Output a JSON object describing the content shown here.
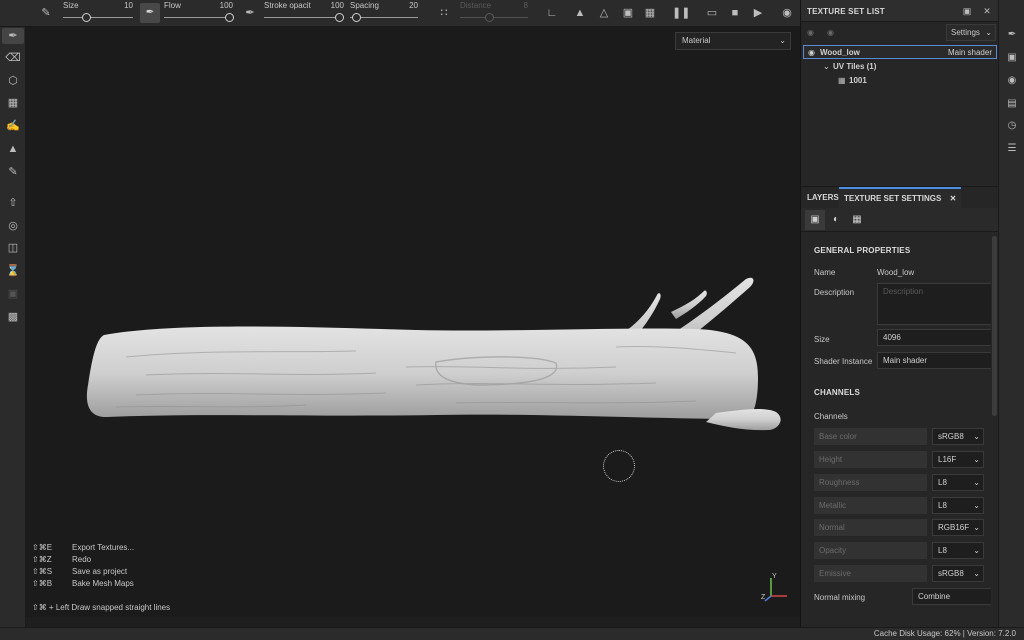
{
  "toolbar": {
    "sliders": [
      {
        "label": "Size",
        "value": "10",
        "level": 0.1
      },
      {
        "label": "Flow",
        "value": "100",
        "level": 1.0
      },
      {
        "label": "Stroke opacit",
        "value": "100",
        "level": 1.0
      },
      {
        "label": "Spacing",
        "value": "20",
        "level": 0.05
      },
      {
        "label": "Distance",
        "value": "8",
        "level": 0.5
      }
    ],
    "icons": [
      "lazy-mouse-icon",
      "brush-stroke-icon",
      "brush-tip-icon",
      "alignment-icon",
      "pattern-icon",
      "symmetry-icon",
      "mirror-icon",
      "snap-icon",
      "crop-icon",
      "pause-icon",
      "frame-icon",
      "cube-icon",
      "camera-icon",
      "screenshot-icon"
    ]
  },
  "left_tools": [
    "paint-brush-icon",
    "eraser-icon",
    "projection-icon",
    "geometry-mask-icon",
    "smudge-icon",
    "clone-stamp-icon",
    "color-picker-icon",
    "export-icon",
    "bake-icon",
    "material-icon",
    "timer-icon",
    "crop-tool-icon",
    "render-icon"
  ],
  "viewport": {
    "material_select": "Material",
    "shortcuts": [
      {
        "key": "⇧⌘E",
        "action": "Export Textures..."
      },
      {
        "key": "⇧⌘Z",
        "action": "Redo"
      },
      {
        "key": "⇧⌘S",
        "action": "Save as project"
      },
      {
        "key": "⇧⌘B",
        "action": "Bake Mesh Maps"
      }
    ],
    "hint": {
      "key": "⇧⌘ + Left",
      "action": "Draw snapped straight lines"
    },
    "axis": {
      "y": "Y",
      "z": "Z"
    }
  },
  "texture_set_list": {
    "title": "TEXTURE SET LIST",
    "settings_label": "Settings",
    "set_name": "Wood_low",
    "shader": "Main shader",
    "uv_tiles": "UV Tiles (1)",
    "tile": "1001"
  },
  "tabs": {
    "layers": "LAYERS",
    "texture_set_settings": "TEXTURE SET SETTINGS"
  },
  "general": {
    "header": "GENERAL PROPERTIES",
    "name_label": "Name",
    "name_value": "Wood_low",
    "description_label": "Description",
    "description_placeholder": "Description",
    "size_label": "Size",
    "size_value": "4096",
    "shader_label": "Shader Instance",
    "shader_value": "Main shader"
  },
  "channels": {
    "header": "CHANNELS",
    "label": "Channels",
    "rows": [
      {
        "name": "Base color",
        "format": "sRGB8"
      },
      {
        "name": "Height",
        "format": "L16F"
      },
      {
        "name": "Roughness",
        "format": "L8"
      },
      {
        "name": "Metallic",
        "format": "L8"
      },
      {
        "name": "Normal",
        "format": "RGB16F"
      },
      {
        "name": "Opacity",
        "format": "L8"
      },
      {
        "name": "Emissive",
        "format": "sRGB8"
      }
    ],
    "normal_mixing_label": "Normal mixing",
    "normal_mixing_value": "Combine"
  },
  "right_strip": [
    "history-icon",
    "display-settings-icon",
    "environment-icon",
    "shelf-icon",
    "clock-icon",
    "log-icon"
  ],
  "status": {
    "text": "Cache Disk Usage:   62% | Version: 7.2.0"
  }
}
